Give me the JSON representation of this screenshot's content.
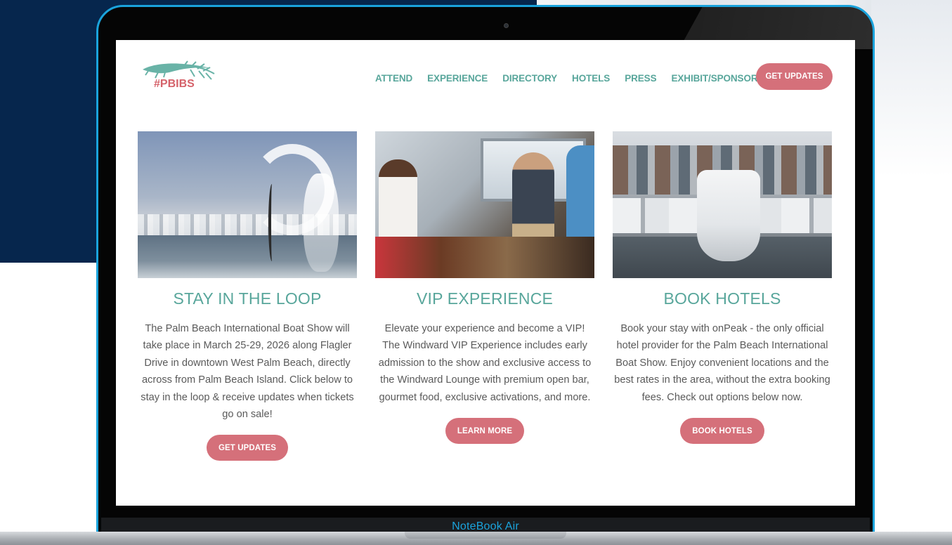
{
  "device": {
    "brand_label": "NoteBook Air"
  },
  "site": {
    "logo_text": "#PBIBS",
    "nav": [
      "ATTEND",
      "EXPERIENCE",
      "DIRECTORY",
      "HOTELS",
      "PRESS",
      "EXHIBIT/SPONSOR"
    ],
    "nav_button": "GET UPDATES"
  },
  "cards": [
    {
      "title": "STAY IN THE LOOP",
      "body": "The Palm Beach International Boat Show will take place in March 25-29, 2026 along Flagler Drive in downtown West Palm Beach, directly across from Palm Beach Island. Click below to stay in the loop & receive updates when tickets go on sale!",
      "button": "GET UPDATES"
    },
    {
      "title": "VIP EXPERIENCE",
      "body": "Elevate your experience and become a VIP! The Windward VIP Experience includes early admission to the show and exclusive access to the Windward Lounge with premium open bar, gourmet food, exclusive activations, and more.",
      "button": "LEARN MORE"
    },
    {
      "title": "BOOK HOTELS",
      "body": "Book your stay with onPeak - the only official hotel provider for the Palm Beach International Boat Show. Enjoy convenient locations and the best rates in the area, without the extra booking fees. Check out options below now.",
      "button": "BOOK HOTELS"
    }
  ],
  "colors": {
    "teal": "#58a69b",
    "coral": "#d5707a",
    "frame_blue": "#1aa3dc",
    "navy": "#06264d"
  }
}
